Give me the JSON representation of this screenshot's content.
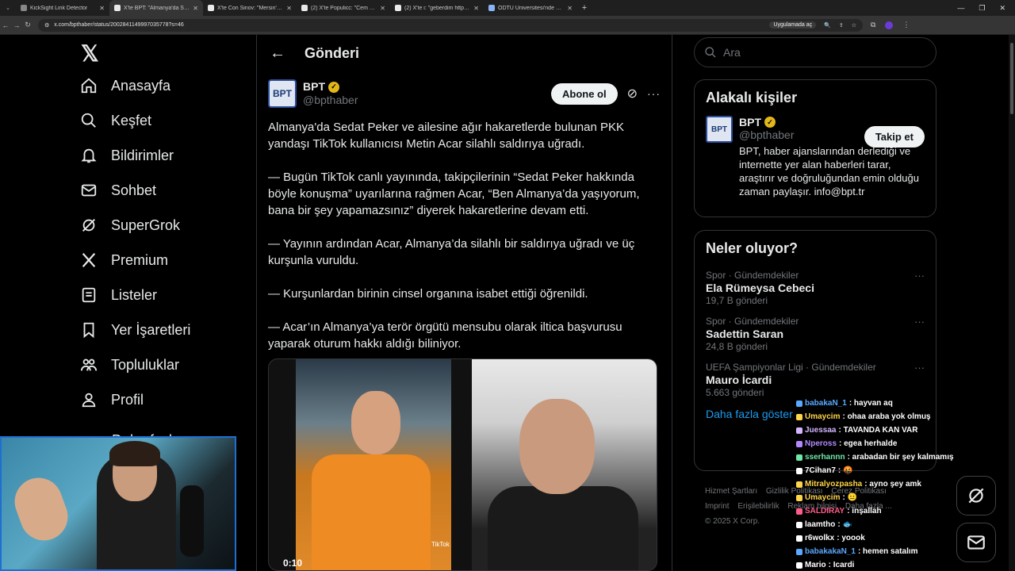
{
  "browser": {
    "tabs": [
      {
        "title": "KickSight Link Detector",
        "active": false
      },
      {
        "title": "X'te BPT: \"Almanya'da Sedat Pe",
        "active": true
      },
      {
        "title": "X'te Con Sinov: \"Mersin'de 12 y",
        "active": false
      },
      {
        "title": "(2) X'te Populicc: \"Cem Yılmaz",
        "active": false
      },
      {
        "title": "(2) X'te i: \"geberdim https://t.co",
        "active": false
      },
      {
        "title": "ODTÜ Üniversitesi'nde Kürtçe",
        "active": false
      }
    ],
    "url": "x.com/bpthaber/status/2002841149997035778?s=46",
    "translate_label": "Uygulamada aç"
  },
  "nav": {
    "items": [
      {
        "name": "home",
        "label": "Anasayfa"
      },
      {
        "name": "explore",
        "label": "Keşfet"
      },
      {
        "name": "notifications",
        "label": "Bildirimler"
      },
      {
        "name": "messages",
        "label": "Sohbet"
      },
      {
        "name": "grok",
        "label": "SuperGrok"
      },
      {
        "name": "premium",
        "label": "Premium"
      },
      {
        "name": "lists",
        "label": "Listeler"
      },
      {
        "name": "bookmarks",
        "label": "Yer İşaretleri"
      },
      {
        "name": "communities",
        "label": "Topluluklar"
      },
      {
        "name": "profile",
        "label": "Profil"
      }
    ],
    "more_label": "Daha fazla"
  },
  "main": {
    "header_title": "Gönderi",
    "author": {
      "display_name": "BPT",
      "handle": "@bpthaber",
      "logo_text": "BPT"
    },
    "subscribe_label": "Abone ol",
    "paragraphs": [
      "Almanya'da Sedat Peker ve ailesine ağır hakaretlerde bulunan PKK yandaşı TikTok kullanıcısı Metin Acar silahlı saldırıya uğradı.",
      "— Bugün TikTok canlı yayınında, takipçilerinin “Sedat Peker hakkında böyle konuşma” uyarılarına rağmen Acar, “Ben Almanya’da yaşıyorum, bana bir şey yapamazsınız” diyerek hakaretlerine devam etti.",
      "— Yayının ardından Acar, Almanya’da silahlı bir saldırıya uğradı ve üç kurşunla vuruldu.",
      "— Kurşunlardan birinin cinsel organına isabet ettiği öğrenildi.",
      "— Acar’ın Almanya’ya terör örgütü mensubu olarak iltica başvurusu yaparak oturum hakkı aldığı biliniyor."
    ],
    "video_time": "0:10",
    "video_watermark": "TikTok"
  },
  "right": {
    "search_placeholder": "Ara",
    "related": {
      "title": "Alakalı kişiler",
      "display_name": "BPT",
      "handle": "@bpthaber",
      "follow_label": "Takip et",
      "bio": "BPT, haber ajanslarından derlediği ve internette yer alan haberleri tarar, araştırır ve doğruluğundan emin olduğu zaman paylaşır. info@bpt.tr"
    },
    "trends": {
      "title": "Neler oluyor?",
      "items": [
        {
          "meta": "Spor · Gündemdekiler",
          "name": "Ela Rümeysa Cebeci",
          "count": "19,7 B gönderi"
        },
        {
          "meta": "Spor · Gündemdekiler",
          "name": "Sadettin Saran",
          "count": "24,8 B gönderi"
        },
        {
          "meta": "UEFA Şampiyonlar Ligi · Gündemdekiler",
          "name": "Mauro İcardi",
          "count": "5.663 gönderi"
        }
      ],
      "show_more": "Daha fazla göster"
    },
    "footer": {
      "links": [
        "Hizmet Şartları",
        "Gizlilik Politikası",
        "Çerez Politikası",
        "Imprint",
        "Erişilebilirlik",
        "Reklam bilgisi",
        "Daha fazla ..."
      ],
      "copyright": "© 2025 X Corp."
    }
  },
  "chat": [
    {
      "user": "babakaN_1",
      "msg": "hayvan aq",
      "color": "#5aa9ff"
    },
    {
      "user": "Umaycim",
      "msg": "ohaa araba yok olmuş",
      "color": "#ffd54a"
    },
    {
      "user": "Juessaa",
      "msg": "TAVANDA KAN VAR",
      "color": "#d3b6ff"
    },
    {
      "user": "Npeross",
      "msg": "egea herhalde",
      "color": "#b388ff"
    },
    {
      "user": "sserhannn",
      "msg": "arabadan bir şey kalmamış",
      "color": "#6ee7a8"
    },
    {
      "user": "7Cihan7",
      "msg": "🤬",
      "color": "#ffffff"
    },
    {
      "user": "Mitralyozpasha",
      "msg": "ayno şey amk",
      "color": "#ffd54a"
    },
    {
      "user": "Umaycim",
      "msg": "😐",
      "color": "#ffd54a"
    },
    {
      "user": "SALDIRAY",
      "msg": "inşallah",
      "color": "#ff5c8a"
    },
    {
      "user": "laamtho",
      "msg": "🐟",
      "color": "#ffffff"
    },
    {
      "user": "r6wolkx",
      "msg": "yoook",
      "color": "#ffffff"
    },
    {
      "user": "babakakaN_1",
      "msg": "hemen satalım",
      "color": "#5aa9ff"
    },
    {
      "user": "Mario",
      "msg": "Icardi",
      "color": "#ffffff"
    }
  ]
}
